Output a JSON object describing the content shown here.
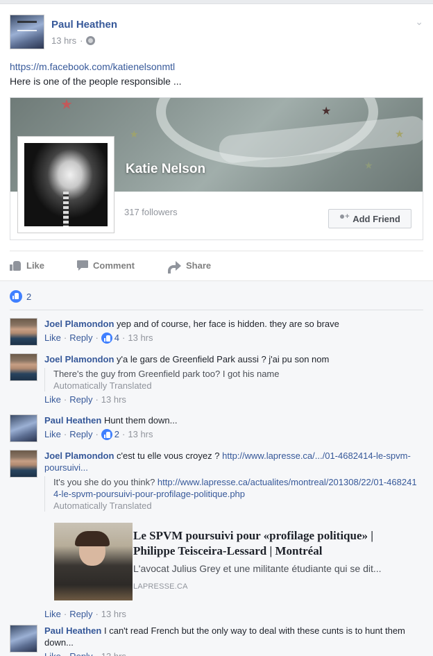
{
  "post": {
    "author": "Paul Heathen",
    "time": "13 hrs",
    "separator": "·",
    "link": "https://m.facebook.com/katienelsonmtl",
    "text": "Here is one of the people responsible ...",
    "menu_icon": "chevron-down-icon",
    "privacy_icon": "globe-icon"
  },
  "attachment": {
    "profile_name": "Katie Nelson",
    "followers": "317 followers",
    "add_friend_label": "Add Friend"
  },
  "actions": {
    "like": "Like",
    "comment": "Comment",
    "share": "Share"
  },
  "reactions": {
    "count": "2"
  },
  "comments": [
    {
      "author": "Joel Plamondon",
      "text": "yep and of course, her face is hidden. they are so brave",
      "like": "Like",
      "reply": "Reply",
      "likes": "4",
      "time": "13 hrs"
    },
    {
      "author": "Joel Plamondon",
      "text": "y'a le gars de Greenfield Park aussi ? j'ai pu son nom",
      "translation": "There's the guy from Greenfield park too? I got his name",
      "auto_translated": "Automatically Translated",
      "like": "Like",
      "reply": "Reply",
      "time": "13 hrs"
    },
    {
      "author": "Paul Heathen",
      "text": "Hunt them down...",
      "like": "Like",
      "reply": "Reply",
      "likes": "2",
      "time": "13 hrs"
    },
    {
      "author": "Joel Plamondon",
      "text": "c'est tu elle vous croyez ?",
      "link": "http://www.lapresse.ca/.../01-4682414-le-spvm-poursuivi...",
      "translation": "It's you she do you think?",
      "translation_link": "http://www.lapresse.ca/actualites/montreal/201308/22/01-4682414-le-spvm-poursuivi-pour-profilage-politique.php",
      "auto_translated": "Automatically Translated",
      "preview_title": "Le SPVM poursuivi pour «profilage politique» | Philippe Teisceira-Lessard | Montréal",
      "preview_desc": "L'avocat Julius Grey et une militante étudiante qui se dit...",
      "preview_domain": "LAPRESSE.CA",
      "like": "Like",
      "reply": "Reply",
      "time": "13 hrs"
    },
    {
      "author": "Paul Heathen",
      "text": "I can't read French but the only way to deal with these cunts is to hunt them down...",
      "like": "Like",
      "reply": "Reply",
      "time": "13 hrs"
    }
  ],
  "colors": {
    "link_blue": "#365899",
    "reaction_blue": "#4080ff",
    "meta_grey": "#90949c"
  }
}
